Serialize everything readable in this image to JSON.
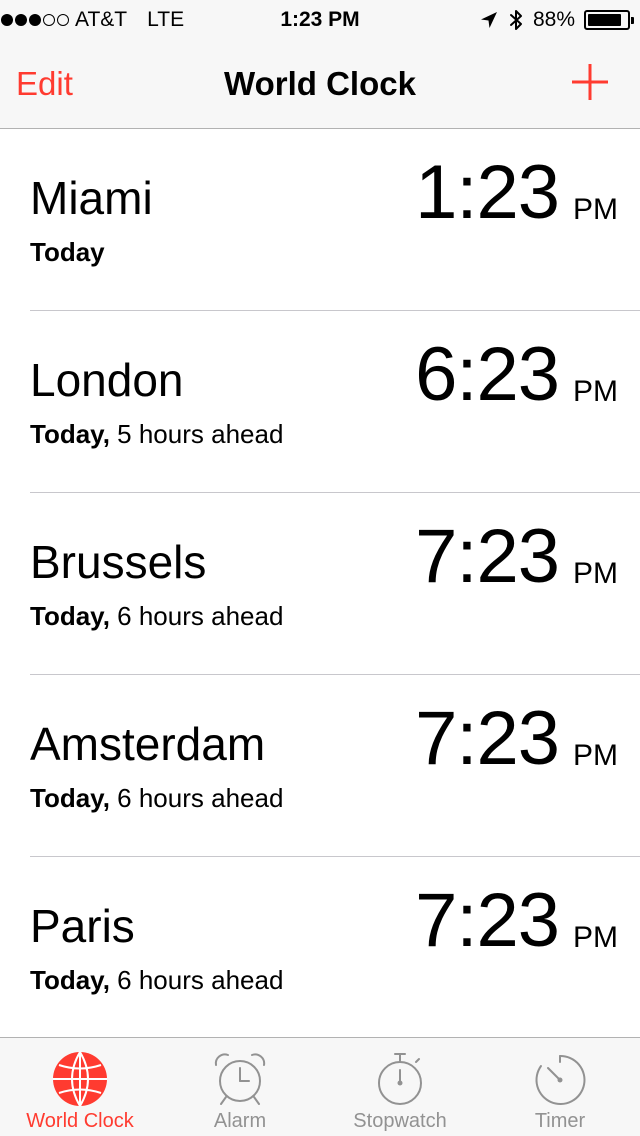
{
  "status_bar": {
    "carrier": "AT&T",
    "network": "LTE",
    "signal_bars_filled": 3,
    "signal_bars_total": 5,
    "time": "1:23 PM",
    "battery_percent": "88%",
    "battery_level": 0.88,
    "icons": [
      "location-arrow-icon",
      "bluetooth-icon",
      "battery-icon"
    ]
  },
  "nav": {
    "edit_label": "Edit",
    "title": "World Clock",
    "add_icon": "plus-icon"
  },
  "clocks": [
    {
      "city": "Miami",
      "day": "Today",
      "offset": "",
      "time": "1:23",
      "ampm": "PM"
    },
    {
      "city": "London",
      "day": "Today,",
      "offset": " 5 hours ahead",
      "time": "6:23",
      "ampm": "PM"
    },
    {
      "city": "Brussels",
      "day": "Today,",
      "offset": " 6 hours ahead",
      "time": "7:23",
      "ampm": "PM"
    },
    {
      "city": "Amsterdam",
      "day": "Today,",
      "offset": " 6 hours ahead",
      "time": "7:23",
      "ampm": "PM"
    },
    {
      "city": "Paris",
      "day": "Today,",
      "offset": " 6 hours ahead",
      "time": "7:23",
      "ampm": "PM"
    }
  ],
  "tabs": [
    {
      "label": "World Clock",
      "icon": "globe-icon",
      "active": true
    },
    {
      "label": "Alarm",
      "icon": "alarm-clock-icon",
      "active": false
    },
    {
      "label": "Stopwatch",
      "icon": "stopwatch-icon",
      "active": false
    },
    {
      "label": "Timer",
      "icon": "timer-icon",
      "active": false
    }
  ],
  "colors": {
    "accent": "#ff3b30",
    "inactive_tab": "#929292",
    "bar_background": "#f7f7f7",
    "separator": "#c8c7cc"
  }
}
